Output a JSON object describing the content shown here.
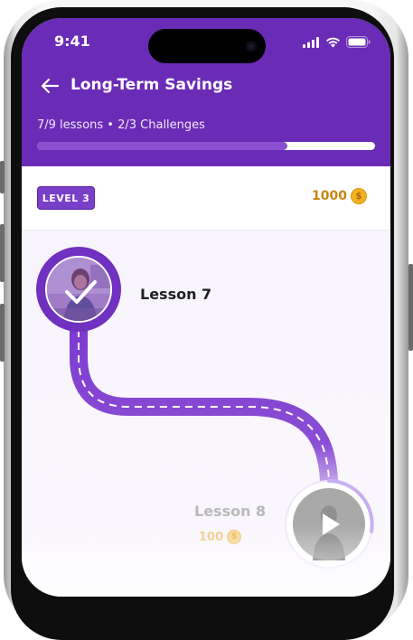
{
  "status_bar": {
    "time": "9:41"
  },
  "header": {
    "title": "Long-Term Savings",
    "progress_text": "7/9 lessons • 2/3 Challenges",
    "progress_fraction": 0.74
  },
  "level_bar": {
    "level_label": "LEVEL 3",
    "coins": "1000"
  },
  "lessons": [
    {
      "label": "Lesson 7",
      "status": "completed"
    },
    {
      "label": "Lesson 8",
      "status": "locked",
      "coins": "100"
    }
  ],
  "colors": {
    "brand_purple": "#6a2bb6",
    "coin_gold": "#c7860f"
  },
  "icons": {
    "back": "arrow-left-icon",
    "signal": "signal-icon",
    "wifi": "wifi-icon",
    "battery": "battery-icon",
    "coin": "coin-icon",
    "check": "check-icon",
    "play": "play-icon"
  }
}
